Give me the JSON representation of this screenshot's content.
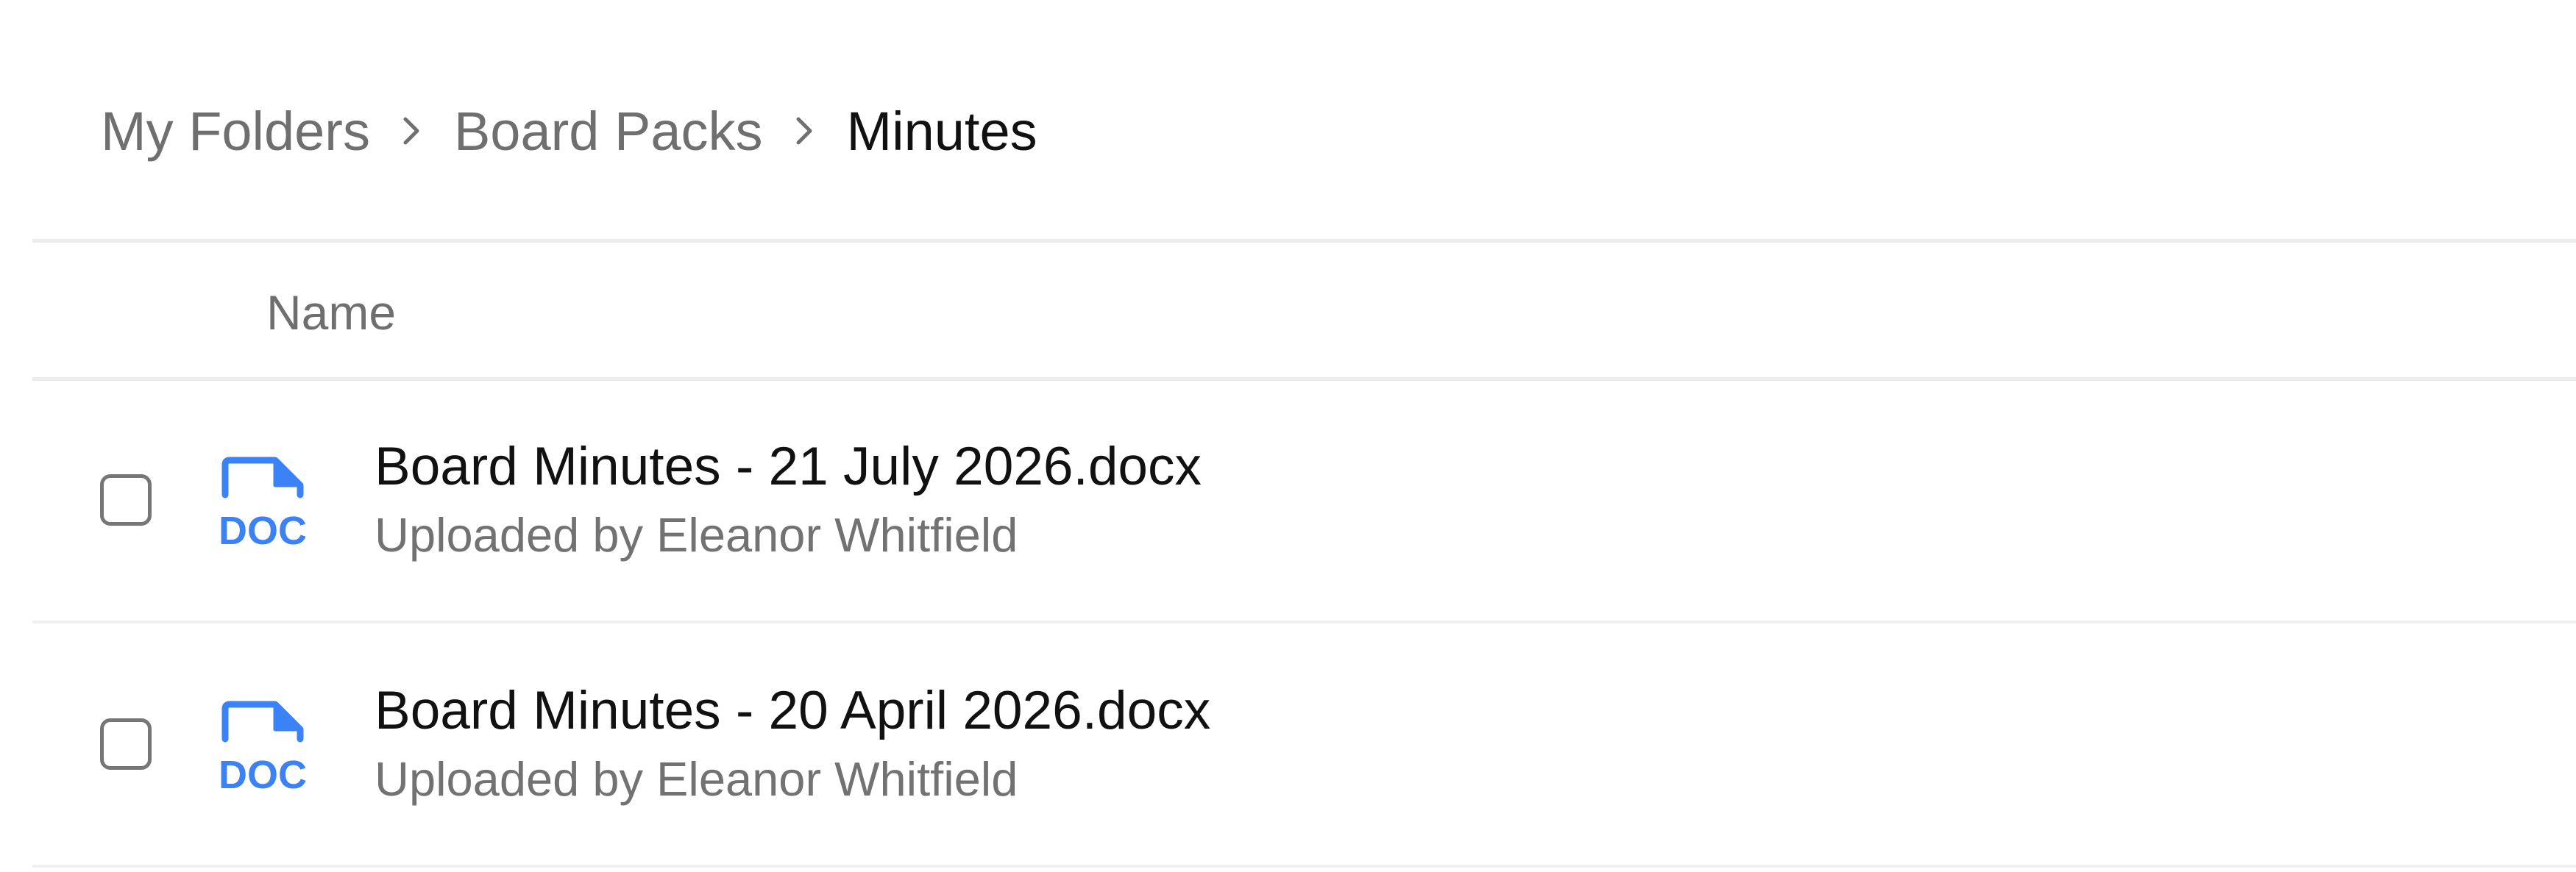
{
  "breadcrumb": {
    "items": [
      "My Folders",
      "Board Packs"
    ],
    "current": "Minutes"
  },
  "table": {
    "columns": [
      "Name"
    ]
  },
  "files": [
    {
      "name": "Board Minutes - 21 July 2026.docx",
      "meta": "Uploaded by Eleanor Whitfield",
      "icon": "doc-file-icon",
      "icon_label": "DOC",
      "checked": false
    },
    {
      "name": "Board Minutes - 20 April 2026.docx",
      "meta": "Uploaded by Eleanor Whitfield",
      "icon": "doc-file-icon",
      "icon_label": "DOC",
      "checked": false
    }
  ],
  "colors": {
    "accent": "#3b82f6"
  }
}
